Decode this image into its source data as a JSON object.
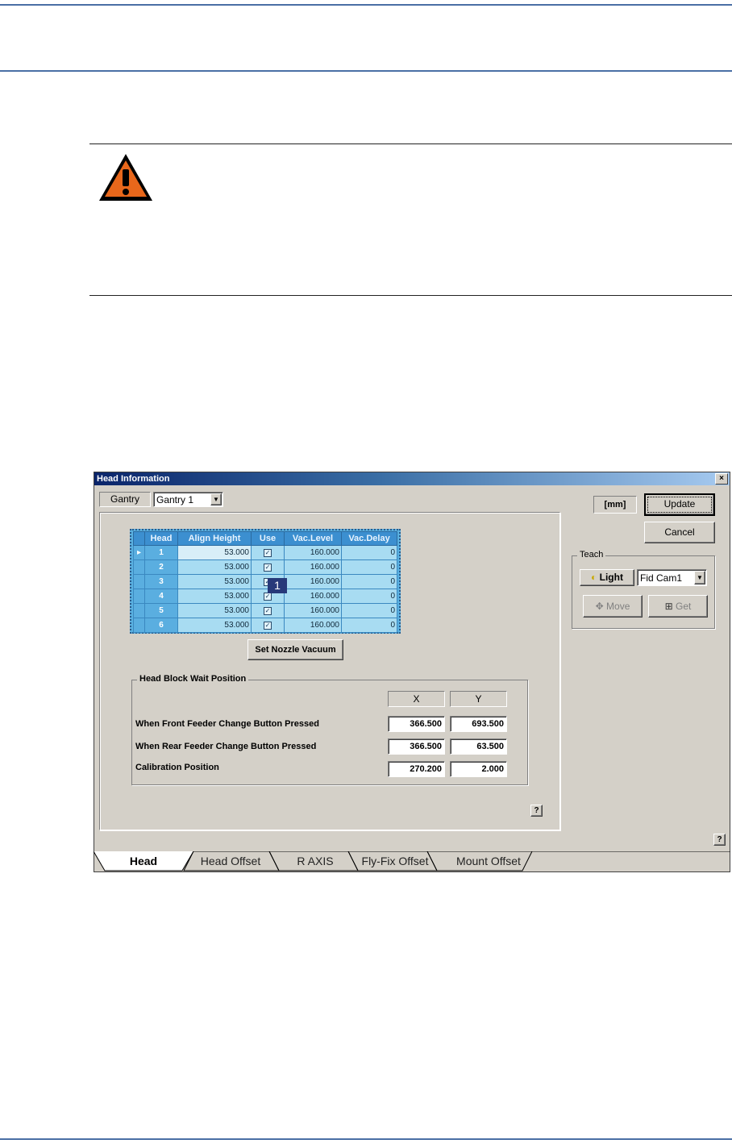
{
  "dialog": {
    "title": "Head Information",
    "close_glyph": "×",
    "gantry": {
      "label": "Gantry",
      "selected": "Gantry 1"
    },
    "units": "[mm]",
    "buttons": {
      "update": "Update",
      "cancel": "Cancel",
      "set_nozzle_vacuum": "Set Nozzle Vacuum",
      "help": "?"
    },
    "teach": {
      "label": "Teach",
      "light": "Light",
      "camera": "Fid Cam1",
      "move": "Move",
      "get": "Get"
    },
    "head_table": {
      "columns": [
        "Head",
        "Align Height",
        "Use",
        "Vac.Level",
        "Vac.Delay"
      ],
      "rows": [
        {
          "head": "1",
          "align_height": "53.000",
          "use": true,
          "vac_level": "160.000",
          "vac_delay": "0"
        },
        {
          "head": "2",
          "align_height": "53.000",
          "use": true,
          "vac_level": "160.000",
          "vac_delay": "0"
        },
        {
          "head": "3",
          "align_height": "53.000",
          "use": true,
          "vac_level": "160.000",
          "vac_delay": "0"
        },
        {
          "head": "4",
          "align_height": "53.000",
          "use": true,
          "vac_level": "160.000",
          "vac_delay": "0"
        },
        {
          "head": "5",
          "align_height": "53.000",
          "use": true,
          "vac_level": "160.000",
          "vac_delay": "0"
        },
        {
          "head": "6",
          "align_height": "53.000",
          "use": true,
          "vac_level": "160.000",
          "vac_delay": "0"
        }
      ],
      "check_glyph": "✓",
      "current_row_marker": "▸"
    },
    "callout": "1",
    "wait_position": {
      "label": "Head Block Wait Position",
      "x_header": "X",
      "y_header": "Y",
      "rows": [
        {
          "label": "When Front Feeder Change Button Pressed",
          "x": "366.500",
          "y": "693.500"
        },
        {
          "label": "When Rear Feeder Change Button Pressed",
          "x": "366.500",
          "y": "63.500"
        },
        {
          "label": "Calibration Position",
          "x": "270.200",
          "y": "2.000"
        }
      ]
    },
    "tabs": [
      "Head",
      "Head Offset",
      "R AXIS",
      "Fly-Fix Offset",
      "Mount Offset"
    ],
    "active_tab": "Head"
  },
  "colors": {
    "accent_rule": "#4a6fa5",
    "warning_orange": "#e8671b",
    "grid_blue": "#5ab0e0"
  }
}
